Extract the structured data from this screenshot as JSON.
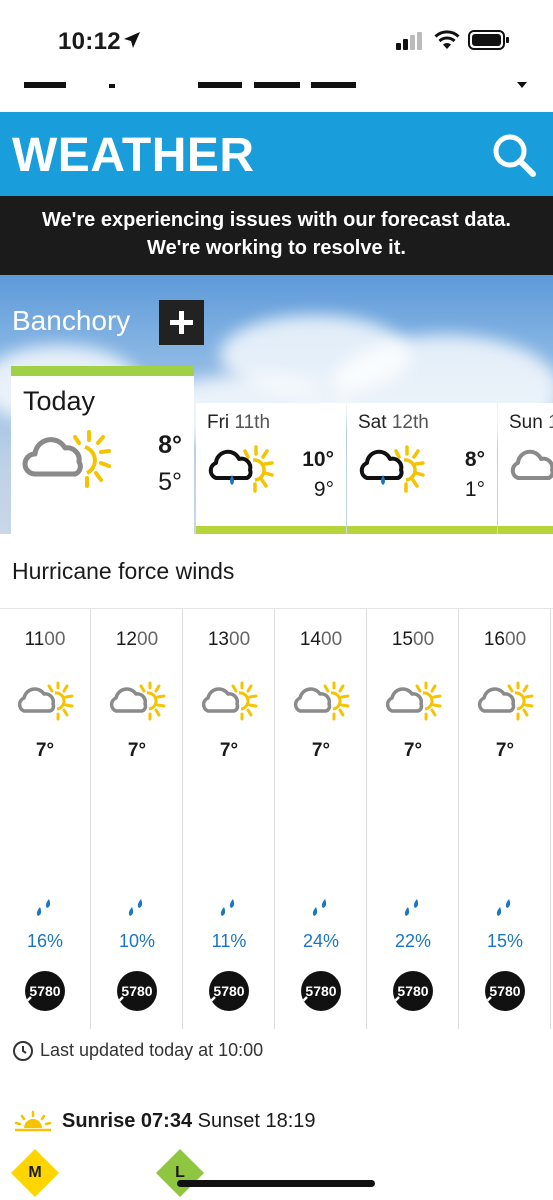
{
  "status": {
    "time": "10:12"
  },
  "header": {
    "title": "WEATHER"
  },
  "alert": {
    "line1": "We're experiencing issues with our forecast data.",
    "line2": "We're working to resolve it."
  },
  "location": {
    "name": "Banchory"
  },
  "today": {
    "label": "Today",
    "max": "8°",
    "min": "5°",
    "icon": "sunny-intervals-icon"
  },
  "days": [
    {
      "day": "Fri",
      "date": "11th",
      "max": "10°",
      "min": "9°",
      "icon": "light-rain-sun-icon"
    },
    {
      "day": "Sat",
      "date": "12th",
      "max": "8°",
      "min": "1°",
      "icon": "light-rain-sun-icon"
    },
    {
      "day": "Sun",
      "date": "1",
      "icon": "sunny-intervals-icon"
    }
  ],
  "warning": {
    "title": "Hurricane force winds"
  },
  "hours": [
    {
      "hh": "11",
      "mm": "00",
      "temp": "7°",
      "rain": "16%",
      "wind": "5780"
    },
    {
      "hh": "12",
      "mm": "00",
      "temp": "7°",
      "rain": "10%",
      "wind": "5780"
    },
    {
      "hh": "13",
      "mm": "00",
      "temp": "7°",
      "rain": "11%",
      "wind": "5780"
    },
    {
      "hh": "14",
      "mm": "00",
      "temp": "7°",
      "rain": "24%",
      "wind": "5780"
    },
    {
      "hh": "15",
      "mm": "00",
      "temp": "7°",
      "rain": "22%",
      "wind": "5780"
    },
    {
      "hh": "16",
      "mm": "00",
      "temp": "7°",
      "rain": "15%",
      "wind": "5780"
    }
  ],
  "updated": {
    "text": "Last updated today at 10:00"
  },
  "sun": {
    "sunrise_label": "Sunrise",
    "sunrise": "07:34",
    "sunset_label": "Sunset",
    "sunset": "18:19"
  },
  "badges": {
    "m": "M",
    "l": "L"
  },
  "colors": {
    "header_blue": "#1a9edb",
    "today_bar": "#9fd045",
    "day_bar": "#b6d43b",
    "rain_blue": "#1b76c2",
    "sun_yellow": "#f5c300",
    "cloud_grey": "#8a8a8a"
  }
}
